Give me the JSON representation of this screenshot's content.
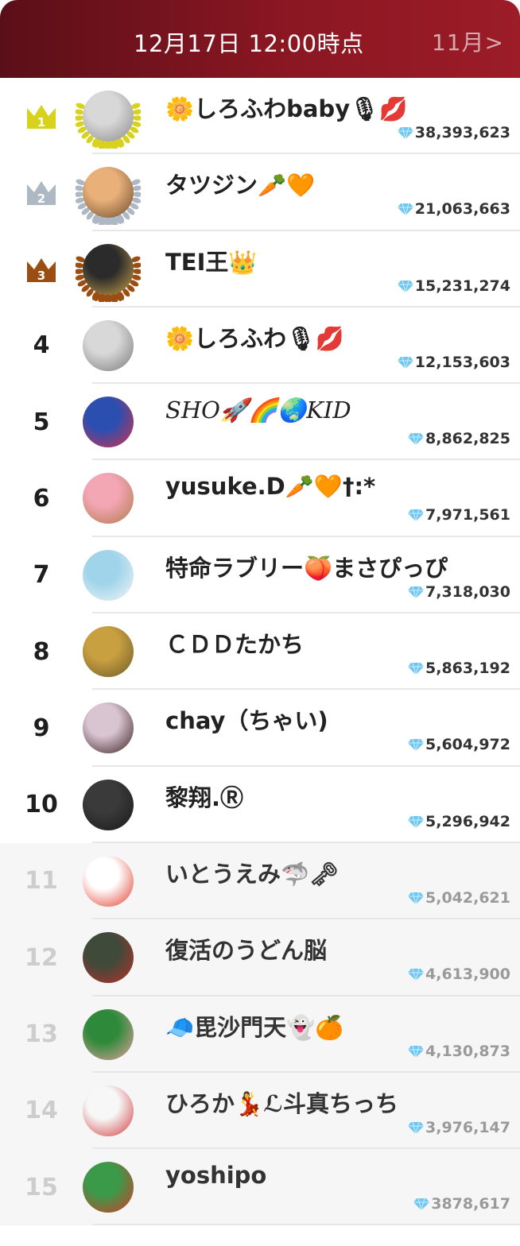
{
  "header": {
    "title": "12月17日 12:00時点",
    "next_month": "11月>"
  },
  "colors": {
    "header_dark": "#5a0f18",
    "header_light": "#9c1c28",
    "gold": "#d9d21c",
    "silver": "#aeb7c4",
    "bronze": "#9a4e12",
    "gem": "#6ec6f2"
  },
  "rows": [
    {
      "rank": "1",
      "name": "🌼しろふわbaby🎙💋",
      "score": "38,393,623",
      "avatar": [
        "#d8d8d8",
        "#8a8a8a"
      ]
    },
    {
      "rank": "2",
      "name": "タツジン🥕🧡",
      "score": "21,063,663",
      "avatar": [
        "#e9b07a",
        "#6b4a2c"
      ]
    },
    {
      "rank": "3",
      "name": "TEI王👑",
      "score": "15,231,274",
      "avatar": [
        "#2b2b2b",
        "#c9a24a"
      ]
    },
    {
      "rank": "4",
      "name": "🌼しろふわ🎙💋",
      "score": "12,153,603",
      "avatar": [
        "#d8d8d8",
        "#7a7a7a"
      ]
    },
    {
      "rank": "5",
      "name": "SHO🚀🌈🌏KID",
      "score": "8,862,825",
      "avatar": [
        "#2b4fb0",
        "#d5304a"
      ]
    },
    {
      "rank": "6",
      "name": "yusuke.D🥕🧡†:*",
      "score": "7,971,561",
      "avatar": [
        "#f3a6b4",
        "#b07a4a"
      ]
    },
    {
      "rank": "7",
      "name": "特命ラブリー🍑まさぴっぴ",
      "score": "7,318,030",
      "avatar": [
        "#9fd4ea",
        "#f5f5f5"
      ]
    },
    {
      "rank": "8",
      "name": "ＣＤＤたかち",
      "score": "5,863,192",
      "avatar": [
        "#c9a040",
        "#6b5a2a"
      ]
    },
    {
      "rank": "9",
      "name": "chay（ちゃい)",
      "score": "5,604,972",
      "avatar": [
        "#d9c5d2",
        "#3a2020"
      ]
    },
    {
      "rank": "10",
      "name": "黎翔.Ⓡ",
      "score": "5,296,942",
      "avatar": [
        "#3a3a3a",
        "#1a1a1a"
      ]
    },
    {
      "rank": "11",
      "name": "いとうえみ🦈🗝",
      "score": "5,042,621",
      "avatar": [
        "#ffffff",
        "#e23a2a"
      ]
    },
    {
      "rank": "12",
      "name": "復活のうどん脳",
      "score": "4,613,900",
      "avatar": [
        "#3f4a3a",
        "#b8302a"
      ]
    },
    {
      "rank": "13",
      "name": "🧢毘沙門天👻🍊",
      "score": "4,130,873",
      "avatar": [
        "#2e8a3a",
        "#e8a0a0"
      ]
    },
    {
      "rank": "14",
      "name": "ひろか💃ℒ斗真ちっち",
      "score": "3,976,147",
      "avatar": [
        "#f7f7f7",
        "#d03a3a"
      ]
    },
    {
      "rank": "15",
      "name": "yoshipo",
      "score": "3878,617",
      "avatar": [
        "#3a9a4a",
        "#d83a2a"
      ]
    }
  ],
  "icons": {
    "crown": "crown-icon",
    "gem": "diamond-icon"
  }
}
